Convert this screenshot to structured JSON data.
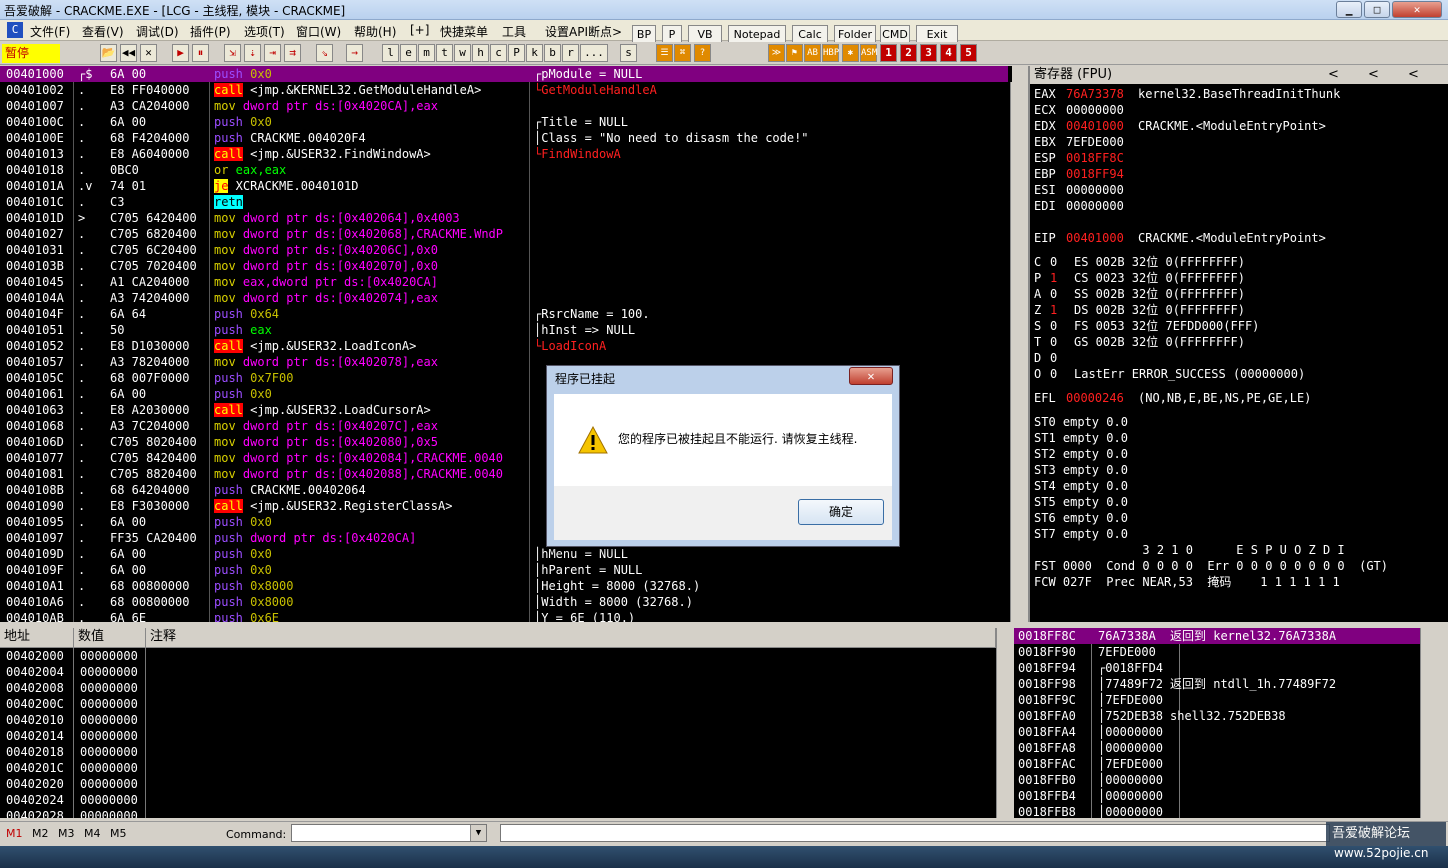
{
  "window": {
    "title": "吾爱破解 - CRACKME.EXE - [LCG - 主线程, 模块 - CRACKME]",
    "controls": [
      "▁",
      "□",
      "✕"
    ]
  },
  "menu": {
    "items": [
      "文件(F)",
      "查看(V)",
      "调试(D)",
      "插件(P)",
      "选项(T)",
      "窗口(W)",
      "帮助(H)",
      "[+]",
      "快捷菜单",
      "工具",
      "设置API断点>"
    ],
    "quick_buttons": [
      "BP",
      "P",
      "VB",
      "Notepad",
      "Calc",
      "Folder",
      "CMD",
      "Exit"
    ]
  },
  "toolbar": {
    "status": "暂停",
    "letters": [
      "l",
      "e",
      "m",
      "t",
      "w",
      "h",
      "c",
      "P",
      "k",
      "b",
      "r",
      "...",
      "s"
    ],
    "numbers": [
      "1",
      "2",
      "3",
      "4",
      "5"
    ]
  },
  "disasm": {
    "rows": [
      {
        "addr": "00401000",
        "mark": "┌$",
        "hex": "6A 00",
        "instr": "push 0x0",
        "cmt": "┌pModule = NULL"
      },
      {
        "addr": "00401002",
        "mark": ".",
        "hex": "E8 FF040000",
        "instr": "call <jmp.&KERNEL32.GetModuleHandleA>",
        "cmt": "└GetModuleHandleA"
      },
      {
        "addr": "00401007",
        "mark": ".",
        "hex": "A3 CA204000",
        "instr": "mov dword ptr ds:[0x4020CA],eax",
        "cmt": ""
      },
      {
        "addr": "0040100C",
        "mark": ".",
        "hex": "6A 00",
        "instr": "push 0x0",
        "cmt": "┌Title = NULL"
      },
      {
        "addr": "0040100E",
        "mark": ".",
        "hex": "68 F4204000",
        "instr": "push CRACKME.004020F4",
        "cmt": "│Class = \"No need to disasm the code!\""
      },
      {
        "addr": "00401013",
        "mark": ".",
        "hex": "E8 A6040000",
        "instr": "call <jmp.&USER32.FindWindowA>",
        "cmt": "└FindWindowA"
      },
      {
        "addr": "00401018",
        "mark": ".",
        "hex": "0BC0",
        "instr": "or eax,eax",
        "cmt": ""
      },
      {
        "addr": "0040101A",
        "mark": ".v",
        "hex": "74 01",
        "instr": "je XCRACKME.0040101D",
        "cmt": ""
      },
      {
        "addr": "0040101C",
        "mark": ".",
        "hex": "C3",
        "instr": "retn",
        "cmt": ""
      },
      {
        "addr": "0040101D",
        "mark": ">",
        "hex": "C705 6420400",
        "instr": "mov dword ptr ds:[0x402064],0x4003",
        "cmt": ""
      },
      {
        "addr": "00401027",
        "mark": ".",
        "hex": "C705 6820400",
        "instr": "mov dword ptr ds:[0x402068],CRACKME.WndP",
        "cmt": ""
      },
      {
        "addr": "00401031",
        "mark": ".",
        "hex": "C705 6C20400",
        "instr": "mov dword ptr ds:[0x40206C],0x0",
        "cmt": ""
      },
      {
        "addr": "0040103B",
        "mark": ".",
        "hex": "C705 7020400",
        "instr": "mov dword ptr ds:[0x402070],0x0",
        "cmt": ""
      },
      {
        "addr": "00401045",
        "mark": ".",
        "hex": "A1 CA204000",
        "instr": "mov eax,dword ptr ds:[0x4020CA]",
        "cmt": ""
      },
      {
        "addr": "0040104A",
        "mark": ".",
        "hex": "A3 74204000",
        "instr": "mov dword ptr ds:[0x402074],eax",
        "cmt": ""
      },
      {
        "addr": "0040104F",
        "mark": ".",
        "hex": "6A 64",
        "instr": "push 0x64",
        "cmt": "┌RsrcName = 100."
      },
      {
        "addr": "00401051",
        "mark": ".",
        "hex": "50",
        "instr": "push eax",
        "cmt": "│hInst => NULL"
      },
      {
        "addr": "00401052",
        "mark": ".",
        "hex": "E8 D1030000",
        "instr": "call <jmp.&USER32.LoadIconA>",
        "cmt": "└LoadIconA"
      },
      {
        "addr": "00401057",
        "mark": ".",
        "hex": "A3 78204000",
        "instr": "mov dword ptr ds:[0x402078],eax",
        "cmt": ""
      },
      {
        "addr": "0040105C",
        "mark": ".",
        "hex": "68 007F0000",
        "instr": "push 0x7F00",
        "cmt": ""
      },
      {
        "addr": "00401061",
        "mark": ".",
        "hex": "6A 00",
        "instr": "push 0x0",
        "cmt": ""
      },
      {
        "addr": "00401063",
        "mark": ".",
        "hex": "E8 A2030000",
        "instr": "call <jmp.&USER32.LoadCursorA>",
        "cmt": ""
      },
      {
        "addr": "00401068",
        "mark": ".",
        "hex": "A3 7C204000",
        "instr": "mov dword ptr ds:[0x40207C],eax",
        "cmt": ""
      },
      {
        "addr": "0040106D",
        "mark": ".",
        "hex": "C705 8020400",
        "instr": "mov dword ptr ds:[0x402080],0x5",
        "cmt": ""
      },
      {
        "addr": "00401077",
        "mark": ".",
        "hex": "C705 8420400",
        "instr": "mov dword ptr ds:[0x402084],CRACKME.0040",
        "cmt": ""
      },
      {
        "addr": "00401081",
        "mark": ".",
        "hex": "C705 8820400",
        "instr": "mov dword ptr ds:[0x402088],CRACKME.0040",
        "cmt": ""
      },
      {
        "addr": "0040108B",
        "mark": ".",
        "hex": "68 64204000",
        "instr": "push CRACKME.00402064",
        "cmt": ""
      },
      {
        "addr": "00401090",
        "mark": ".",
        "hex": "E8 F3030000",
        "instr": "call <jmp.&USER32.RegisterClassA>",
        "cmt": ""
      },
      {
        "addr": "00401095",
        "mark": ".",
        "hex": "6A 00",
        "instr": "push 0x0",
        "cmt": ""
      },
      {
        "addr": "00401097",
        "mark": ".",
        "hex": "FF35 CA20400",
        "instr": "push dword ptr ds:[0x4020CA]",
        "cmt": ""
      },
      {
        "addr": "0040109D",
        "mark": ".",
        "hex": "6A 00",
        "instr": "push 0x0",
        "cmt": "│hMenu = NULL"
      },
      {
        "addr": "0040109F",
        "mark": ".",
        "hex": "6A 00",
        "instr": "push 0x0",
        "cmt": "│hParent = NULL"
      },
      {
        "addr": "004010A1",
        "mark": ".",
        "hex": "68 00800000",
        "instr": "push 0x8000",
        "cmt": "│Height = 8000 (32768.)"
      },
      {
        "addr": "004010A6",
        "mark": ".",
        "hex": "68 00800000",
        "instr": "push 0x8000",
        "cmt": "│Width = 8000 (32768.)"
      },
      {
        "addr": "004010AB",
        "mark": ".",
        "hex": "6A 6E",
        "instr": "push 0x6E",
        "cmt": "│Y = 6E (110.)"
      }
    ]
  },
  "registers": {
    "header": "寄存器 (FPU)",
    "arrows": [
      "<",
      "<",
      "<"
    ],
    "lines": [
      {
        "name": "EAX",
        "val": "76A73378",
        "red": true,
        "desc": "kernel32.BaseThreadInitThunk"
      },
      {
        "name": "ECX",
        "val": "00000000",
        "red": false,
        "desc": ""
      },
      {
        "name": "EDX",
        "val": "00401000",
        "red": true,
        "desc": "CRACKME.<ModuleEntryPoint>"
      },
      {
        "name": "EBX",
        "val": "7EFDE000",
        "red": false,
        "desc": ""
      },
      {
        "name": "ESP",
        "val": "0018FF8C",
        "red": true,
        "desc": ""
      },
      {
        "name": "EBP",
        "val": "0018FF94",
        "red": true,
        "desc": ""
      },
      {
        "name": "ESI",
        "val": "00000000",
        "red": false,
        "desc": ""
      },
      {
        "name": "EDI",
        "val": "00000000",
        "red": false,
        "desc": ""
      },
      {
        "name": "",
        "val": "",
        "red": false,
        "desc": ""
      },
      {
        "name": "EIP",
        "val": "00401000",
        "red": true,
        "desc": "CRACKME.<ModuleEntryPoint>"
      }
    ],
    "flags": [
      {
        "f": "C",
        "v": "0",
        "red": false,
        "seg": "ES 002B 32位 0(FFFFFFFF)"
      },
      {
        "f": "P",
        "v": "1",
        "red": true,
        "seg": "CS 0023 32位 0(FFFFFFFF)"
      },
      {
        "f": "A",
        "v": "0",
        "red": false,
        "seg": "SS 002B 32位 0(FFFFFFFF)"
      },
      {
        "f": "Z",
        "v": "1",
        "red": true,
        "seg": "DS 002B 32位 0(FFFFFFFF)"
      },
      {
        "f": "S",
        "v": "0",
        "red": false,
        "seg": "FS 0053 32位 7EFDD000(FFF)"
      },
      {
        "f": "T",
        "v": "0",
        "red": false,
        "seg": "GS 002B 32位 0(FFFFFFFF)"
      },
      {
        "f": "D",
        "v": "0",
        "red": false,
        "seg": ""
      },
      {
        "f": "O",
        "v": "0",
        "red": false,
        "seg": "LastErr ERROR_SUCCESS (00000000)"
      }
    ],
    "efl": {
      "label": "EFL",
      "val": "00000246",
      "desc": "(NO,NB,E,BE,NS,PE,GE,LE)"
    },
    "st": [
      "ST0 empty 0.0",
      "ST1 empty 0.0",
      "ST2 empty 0.0",
      "ST3 empty 0.0",
      "ST4 empty 0.0",
      "ST5 empty 0.0",
      "ST6 empty 0.0",
      "ST7 empty 0.0"
    ],
    "fpu_bits_header": "               3 2 1 0      E S P U O Z D I",
    "fst": "FST 0000  Cond 0 0 0 0  Err 0 0 0 0 0 0 0 0  (GT)",
    "fcw": "FCW 027F  Prec NEAR,53  掩码    1 1 1 1 1 1"
  },
  "dump": {
    "headers": [
      "地址",
      "数值",
      "注释"
    ],
    "rows": [
      [
        "00402000",
        "00000000"
      ],
      [
        "00402004",
        "00000000"
      ],
      [
        "00402008",
        "00000000"
      ],
      [
        "0040200C",
        "00000000"
      ],
      [
        "00402010",
        "00000000"
      ],
      [
        "00402014",
        "00000000"
      ],
      [
        "00402018",
        "00000000"
      ],
      [
        "0040201C",
        "00000000"
      ],
      [
        "00402020",
        "00000000"
      ],
      [
        "00402024",
        "00000000"
      ],
      [
        "00402028",
        "00000000"
      ]
    ]
  },
  "stack": {
    "rows": [
      {
        "addr": "0018FF8C",
        "val": "76A7338A",
        "cmt": "返回到 kernel32.76A7338A",
        "hl": true
      },
      {
        "addr": "0018FF90",
        "val": "7EFDE000",
        "cmt": "",
        "hl": false
      },
      {
        "addr": "0018FF94",
        "val": "┌0018FFD4",
        "cmt": "",
        "hl": false
      },
      {
        "addr": "0018FF98",
        "val": "│77489F72",
        "cmt": "返回到 ntdll_1h.77489F72",
        "hl": false
      },
      {
        "addr": "0018FF9C",
        "val": "│7EFDE000",
        "cmt": "",
        "hl": false
      },
      {
        "addr": "0018FFA0",
        "val": "│752DEB38",
        "cmt": "shell32.752DEB38",
        "hl": false
      },
      {
        "addr": "0018FFA4",
        "val": "│00000000",
        "cmt": "",
        "hl": false
      },
      {
        "addr": "0018FFA8",
        "val": "│00000000",
        "cmt": "",
        "hl": false
      },
      {
        "addr": "0018FFAC",
        "val": "│7EFDE000",
        "cmt": "",
        "hl": false
      },
      {
        "addr": "0018FFB0",
        "val": "│00000000",
        "cmt": "",
        "hl": false
      },
      {
        "addr": "0018FFB4",
        "val": "│00000000",
        "cmt": "",
        "hl": false
      },
      {
        "addr": "0018FFB8",
        "val": "│00000000",
        "cmt": "",
        "hl": false
      }
    ]
  },
  "dialog": {
    "title": "程序已挂起",
    "close": "✕",
    "message": "您的程序已被挂起且不能运行. 请恢复主线程.",
    "ok": "确定"
  },
  "bottom": {
    "mtabs": [
      "M1",
      "M2",
      "M3",
      "M4",
      "M5"
    ],
    "command_label": "Command:",
    "command_value": "",
    "watermark": "吾爱破解论坛",
    "watermark_url": "www.52pojie.cn"
  }
}
